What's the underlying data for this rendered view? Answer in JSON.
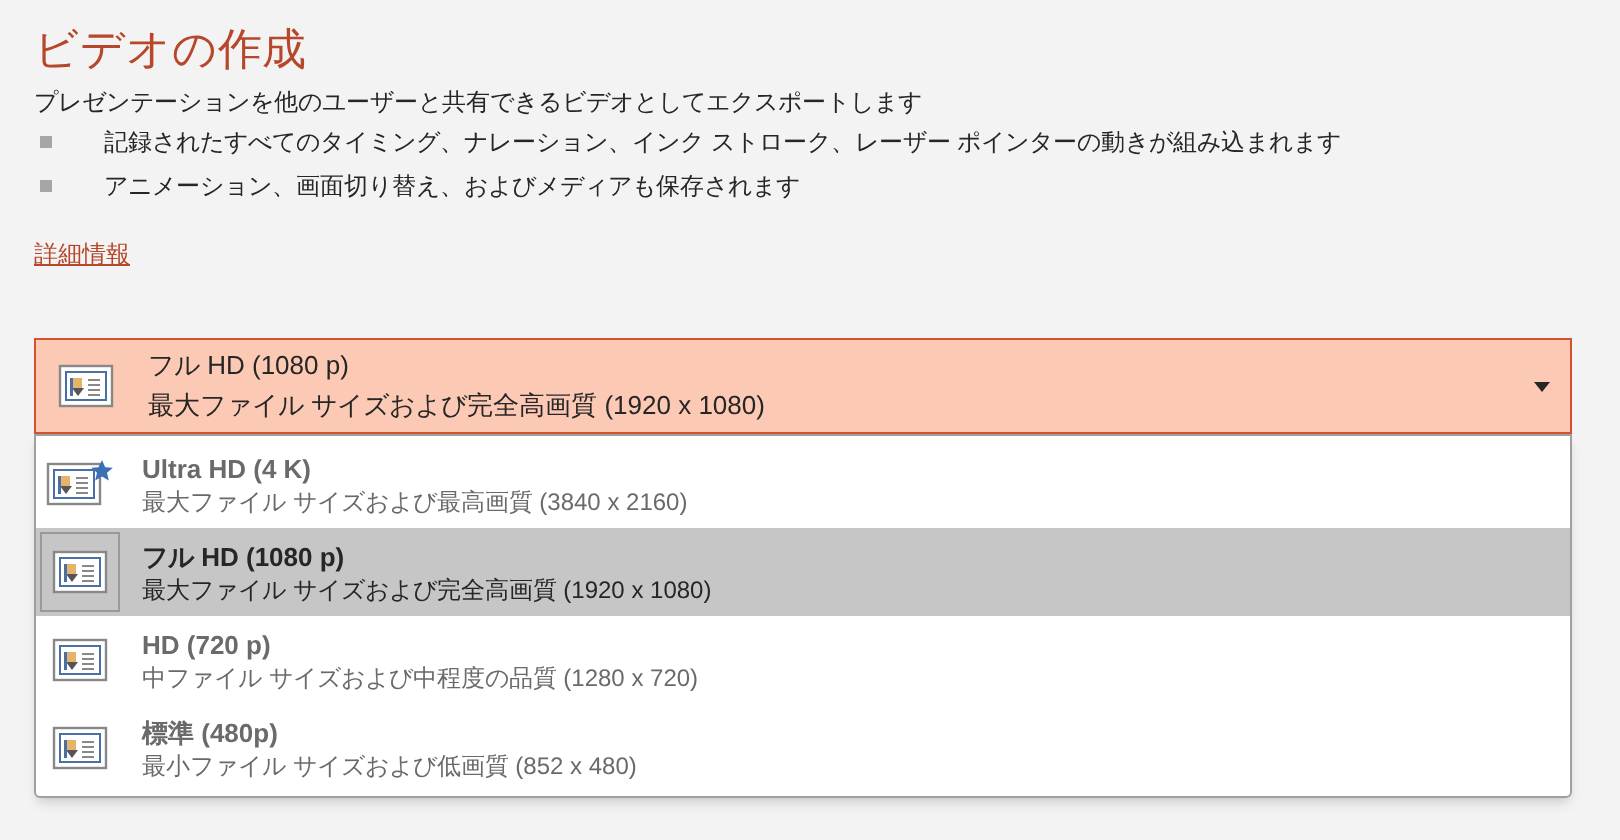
{
  "title": "ビデオの作成",
  "description": "プレゼンテーションを他のユーザーと共有できるビデオとしてエクスポートします",
  "bullets": [
    "記録されたすべてのタイミング、ナレーション、インク ストローク、レーザー ポインターの動きが組み込まれます",
    "アニメーション、画面切り替え、およびメディアも保存されます"
  ],
  "link": "詳細情報",
  "dropdown": {
    "title": "フル HD (1080 p)",
    "subtitle": "最大ファイル サイズおよび完全高画質 (1920 x 1080)",
    "expanded": true
  },
  "options": [
    {
      "title": "Ultra HD (4 K)",
      "subtitle": "最大ファイル サイズおよび最高画質 (3840 x 2160)",
      "selected": false
    },
    {
      "title": "フル HD (1080 p)",
      "subtitle": "最大ファイル サイズおよび完全高画質 (1920 x 1080)",
      "selected": true
    },
    {
      "title": "HD (720 p)",
      "subtitle": "中ファイル サイズおよび中程度の品質 (1280 x 720)",
      "selected": false
    },
    {
      "title": "標準 (480p)",
      "subtitle": "最小ファイル サイズおよび低画質 (852 x 480)",
      "selected": false
    }
  ]
}
